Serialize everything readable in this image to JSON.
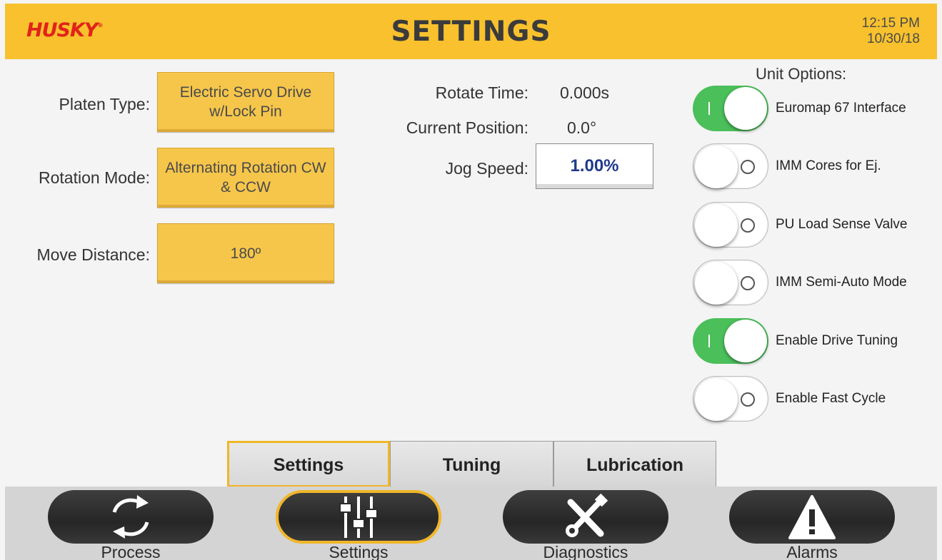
{
  "header": {
    "logo": "HUSKY",
    "logo_mark": "®",
    "title": "SETTINGS",
    "time": "12:15 PM",
    "date": "10/30/18"
  },
  "left": {
    "platen_type_label": "Platen Type:",
    "platen_type_value": "Electric Servo Drive w/Lock Pin",
    "rotation_mode_label": "Rotation Mode:",
    "rotation_mode_value": "Alternating Rotation CW & CCW",
    "move_distance_label": "Move Distance:",
    "move_distance_value": "180º"
  },
  "middle": {
    "rotate_time_label": "Rotate Time:",
    "rotate_time_value": "0.000s",
    "current_position_label": "Current Position:",
    "current_position_value": "0.0°",
    "jog_speed_label": "Jog Speed:",
    "jog_speed_value": "1.00%"
  },
  "unit_options": {
    "title": "Unit Options:",
    "items": [
      {
        "label": "Euromap 67 Interface",
        "on": true
      },
      {
        "label": "IMM Cores for Ej.",
        "on": false
      },
      {
        "label": "PU Load Sense Valve",
        "on": false
      },
      {
        "label": "IMM Semi-Auto Mode",
        "on": false
      },
      {
        "label": "Enable Drive Tuning",
        "on": true
      },
      {
        "label": "Enable Fast Cycle",
        "on": false
      }
    ]
  },
  "tabs": [
    {
      "label": "Settings",
      "active": true
    },
    {
      "label": "Tuning",
      "active": false
    },
    {
      "label": "Lubrication",
      "active": false
    }
  ],
  "nav": [
    {
      "label": "Process",
      "icon": "refresh-arrows-icon",
      "active": false
    },
    {
      "label": "Settings",
      "icon": "sliders-icon",
      "active": true
    },
    {
      "label": "Diagnostics",
      "icon": "tools-icon",
      "active": false
    },
    {
      "label": "Alarms",
      "icon": "warning-icon",
      "active": false
    }
  ],
  "colors": {
    "header_bg": "#f8c12d",
    "logo": "#e2231a",
    "button_yellow": "#f6c64b",
    "toggle_on": "#4bbf5a",
    "active_outline": "#f0b62a",
    "jog_value": "#1f3a8a"
  }
}
